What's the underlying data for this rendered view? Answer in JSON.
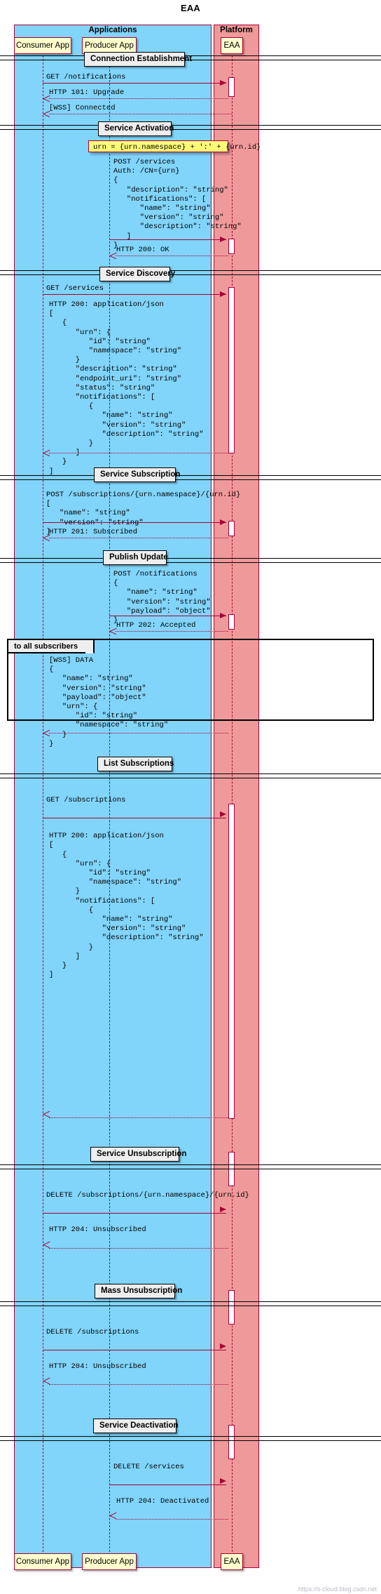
{
  "diagram": {
    "title": "EAA",
    "watermark": "https://s-cloud.blog.csdn.net"
  },
  "boxes": [
    {
      "name": "Applications",
      "label": "Applications",
      "color": "#81D4FA"
    },
    {
      "name": "Platform",
      "label": "Platform",
      "color": "#EF9A9A"
    }
  ],
  "participants": [
    {
      "id": "consumer",
      "label": "Consumer App"
    },
    {
      "id": "producer",
      "label": "Producer App"
    },
    {
      "id": "eaa",
      "label": "EAA"
    }
  ],
  "dividers": [
    {
      "label": "Connection Establishment"
    },
    {
      "label": "Service Activation"
    },
    {
      "label": "Service Discovery"
    },
    {
      "label": "Service Subscription"
    },
    {
      "label": "Publish Update"
    },
    {
      "label": "List Subscriptions"
    },
    {
      "label": "Service Unsubscription"
    },
    {
      "label": "Mass Unsubscription"
    },
    {
      "label": "Service Deactivation"
    }
  ],
  "notes": [
    {
      "id": "urn-note",
      "text": "urn = {urn.namespace} + ':' + {urn.id}"
    }
  ],
  "groups": [
    {
      "id": "broadcast",
      "label": "to all subscribers"
    }
  ],
  "messages": [
    {
      "id": "m1",
      "from": "consumer",
      "to": "eaa",
      "style": "solid",
      "text": "GET /notifications"
    },
    {
      "id": "m2",
      "from": "eaa",
      "to": "consumer",
      "style": "dotted",
      "text": "HTTP 101: Upgrade"
    },
    {
      "id": "m3",
      "from": "eaa",
      "to": "consumer",
      "style": "dotted",
      "text": "[WSS] Connected"
    },
    {
      "id": "m4",
      "from": "producer",
      "to": "eaa",
      "style": "solid",
      "text": "POST /services\nAuth: /CN={urn}\n{\n   \"description\": \"string\"\n   \"notifications\": [\n      \"name\": \"string\"\n      \"version\": \"string\"\n      \"description\": \"string\"\n   ]\n}"
    },
    {
      "id": "m5",
      "from": "eaa",
      "to": "producer",
      "style": "dotted",
      "text": "HTTP 200: OK"
    },
    {
      "id": "m6",
      "from": "consumer",
      "to": "eaa",
      "style": "solid",
      "text": "GET /services"
    },
    {
      "id": "m7",
      "from": "eaa",
      "to": "consumer",
      "style": "dotted",
      "text": "HTTP 200: application/json\n[\n   {\n      \"urn\": {\n         \"id\": \"string\"\n         \"namespace\": \"string\"\n      }\n      \"description\": \"string\"\n      \"endpoint_uri\": \"string\"\n      \"status\": \"string\"\n      \"notifications\": [\n         {\n            \"name\": \"string\"\n            \"version\": \"string\"\n            \"description\": \"string\"\n         }\n      ]\n   }\n]"
    },
    {
      "id": "m8",
      "from": "consumer",
      "to": "eaa",
      "style": "solid",
      "text": "POST /subscriptions/{urn.namespace}/{urn.id}\n[\n   \"name\": \"string\"\n   \"version\": \"string\"\n]"
    },
    {
      "id": "m9",
      "from": "eaa",
      "to": "consumer",
      "style": "dotted",
      "text": "HTTP 201: Subscribed"
    },
    {
      "id": "m10",
      "from": "producer",
      "to": "eaa",
      "style": "solid",
      "text": "POST /notifications\n{\n   \"name\": \"string\"\n   \"version\": \"string\"\n   \"payload\": \"object\"\n}"
    },
    {
      "id": "m11",
      "from": "eaa",
      "to": "producer",
      "style": "dotted",
      "text": "HTTP 202: Accepted"
    },
    {
      "id": "m12",
      "from": "eaa",
      "to": "consumer",
      "style": "dotted",
      "text": "[WSS] DATA\n{\n   \"name\": \"string\"\n   \"version\": \"string\"\n   \"payload\": \"object\"\n   \"urn\": {\n      \"id\": \"string\"\n      \"namespace\": \"string\"\n   }\n}"
    },
    {
      "id": "m13",
      "from": "consumer",
      "to": "eaa",
      "style": "solid",
      "text": "GET /subscriptions"
    },
    {
      "id": "m14",
      "from": "eaa",
      "to": "consumer",
      "style": "dotted",
      "text": "HTTP 200: application/json\n[\n   {\n      \"urn\": {\n         \"id\": \"string\"\n         \"namespace\": \"string\"\n      }\n      \"notifications\": [\n         {\n            \"name\": \"string\"\n            \"version\": \"string\"\n            \"description\": \"string\"\n         }\n      ]\n   }\n]"
    },
    {
      "id": "m15",
      "from": "consumer",
      "to": "eaa",
      "style": "solid",
      "text": "DELETE /subscriptions/{urn.namespace}/{urn.id}"
    },
    {
      "id": "m16",
      "from": "eaa",
      "to": "consumer",
      "style": "dotted",
      "text": "HTTP 204: Unsubscribed"
    },
    {
      "id": "m17",
      "from": "consumer",
      "to": "eaa",
      "style": "solid",
      "text": "DELETE /subscriptions"
    },
    {
      "id": "m18",
      "from": "eaa",
      "to": "consumer",
      "style": "dotted",
      "text": "HTTP 204: Unsubscribed"
    },
    {
      "id": "m19",
      "from": "producer",
      "to": "eaa",
      "style": "solid",
      "text": "DELETE /services"
    },
    {
      "id": "m20",
      "from": "eaa",
      "to": "producer",
      "style": "dotted",
      "text": "HTTP 204: Deactivated"
    }
  ]
}
